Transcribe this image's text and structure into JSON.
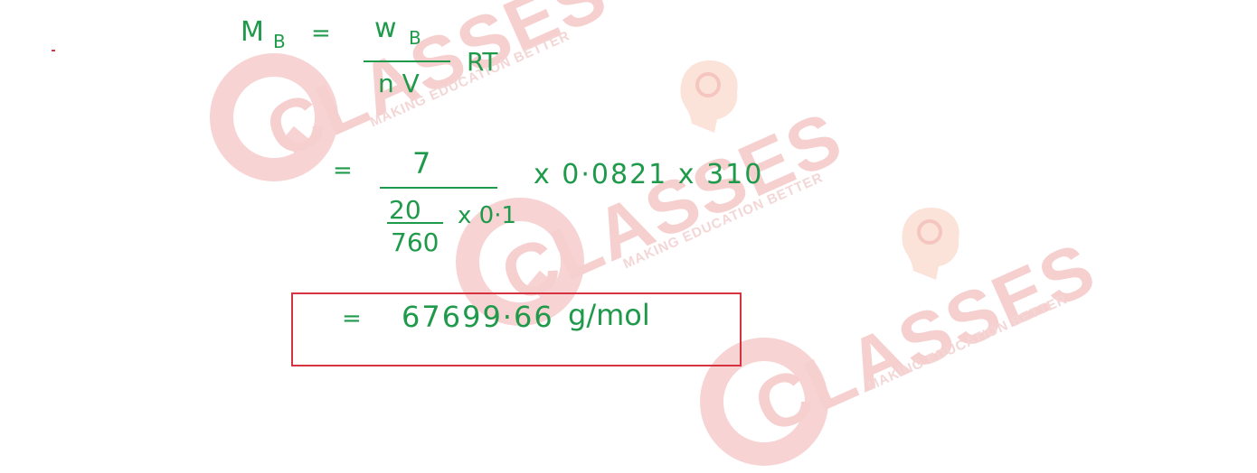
{
  "watermark": {
    "brand": "CLASSES",
    "tagline": "MAKING EDUCATION BETTER",
    "color": "#f6cfcf"
  },
  "formula": {
    "lhs": "M",
    "lhs_sub": "B",
    "equals": "=",
    "numerator": "w",
    "numerator_sub": "B",
    "denominator": "n V",
    "factor": "RT"
  },
  "substitution": {
    "equals": "=",
    "numerator": "7",
    "inner_numerator": "20",
    "inner_denominator": "760",
    "inner_factor": "x 0·1",
    "tail": "x  0·0821  x 310"
  },
  "result": {
    "equals": "=",
    "value": "67699·66",
    "unit": "g/mol"
  },
  "colors": {
    "ink": "#1f9a4b",
    "box": "#d6323f"
  }
}
